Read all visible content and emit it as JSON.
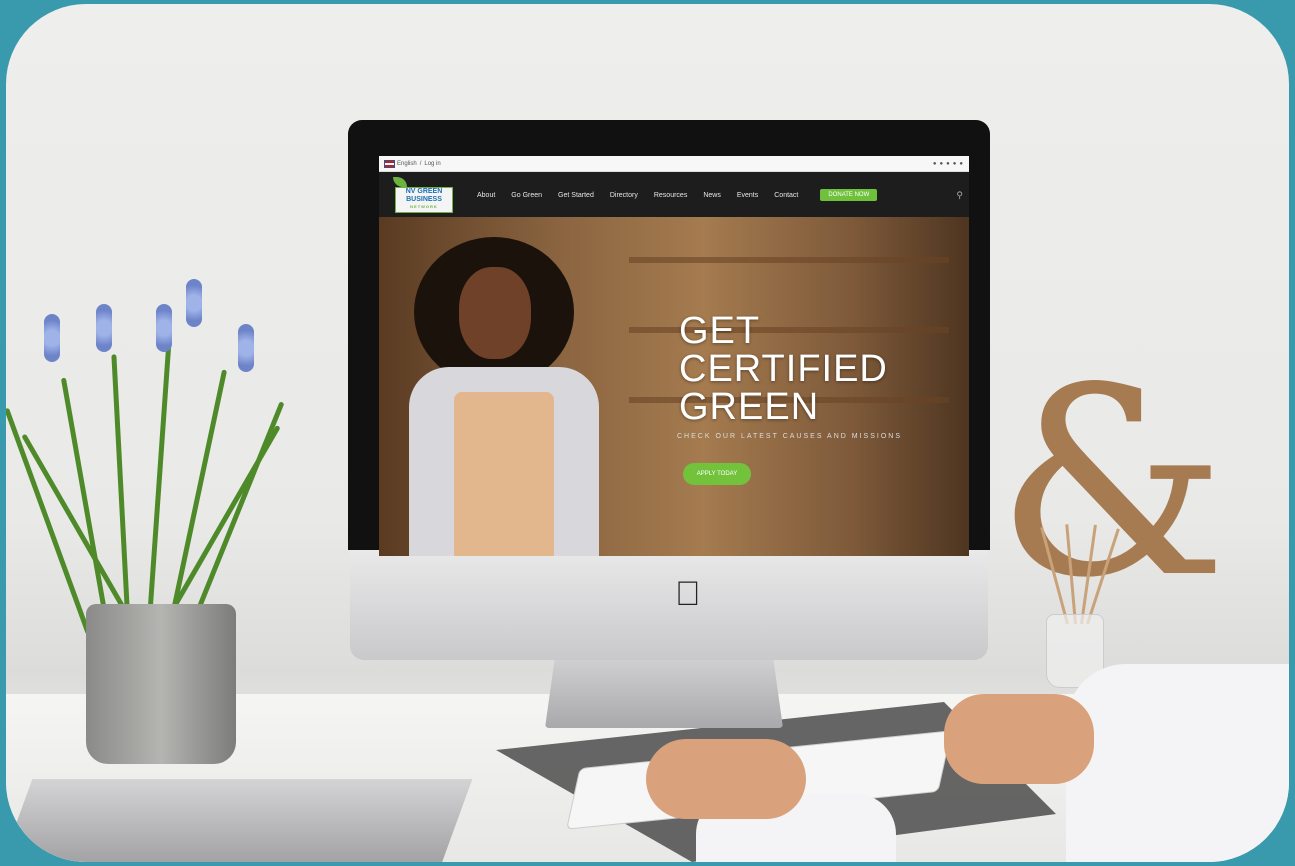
{
  "site": {
    "topbar": {
      "language": "English",
      "separator": "/",
      "login": "Log in",
      "social_icons": [
        "twitter-icon",
        "facebook-icon",
        "instagram-icon",
        "linkedin-icon",
        "youtube-icon"
      ]
    },
    "logo": {
      "line1": "NV GREEN",
      "line2": "BUSINESS",
      "line3": "NETWORK"
    },
    "nav": [
      "About",
      "Go Green",
      "Get Started",
      "Directory",
      "Resources",
      "News",
      "Events",
      "Contact"
    ],
    "donate_label": "DONATE NOW",
    "hero": {
      "headline_line1": "GET",
      "headline_line2": "CERTIFIED",
      "headline_line3": "GREEN",
      "subtext": "CHECK OUR LATEST CAUSES AND MISSIONS",
      "button_label": "APPLY TODAY"
    }
  },
  "colors": {
    "background": "#3a9aad",
    "accent_green": "#6fc13b",
    "nav_bg": "#1d1d1d"
  },
  "icons": {
    "apple_logo": "apple-icon",
    "search": "search-icon"
  }
}
